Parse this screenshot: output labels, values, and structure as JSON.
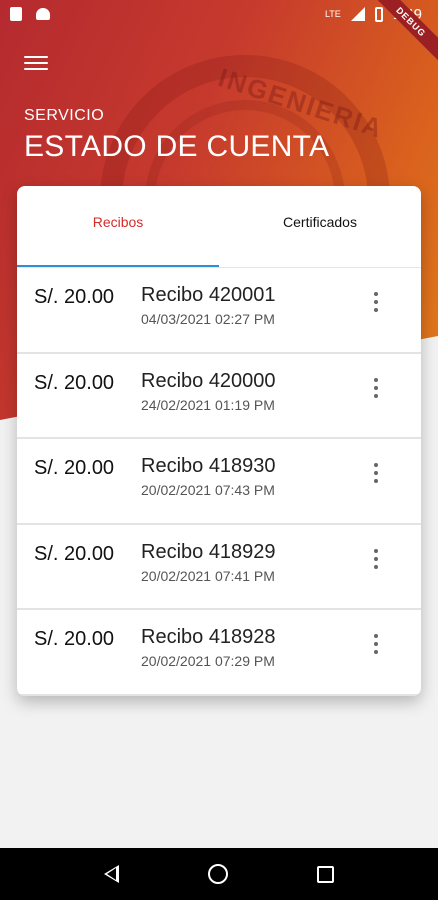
{
  "status_bar": {
    "network": "LTE",
    "time": "1:49",
    "debug_banner": "DEBUG"
  },
  "header": {
    "section": "SERVICIO",
    "title": "ESTADO DE CUENTA",
    "watermark_text": "INGENIERIA"
  },
  "tabs": [
    {
      "label": "Recibos",
      "active": true
    },
    {
      "label": "Certificados",
      "active": false
    }
  ],
  "receipts": [
    {
      "amount": "S/. 20.00",
      "title": "Recibo 420001",
      "date": "04/03/2021 02:27 PM"
    },
    {
      "amount": "S/. 20.00",
      "title": "Recibo 420000",
      "date": "24/02/2021 01:19 PM"
    },
    {
      "amount": "S/. 20.00",
      "title": "Recibo 418930",
      "date": "20/02/2021 07:43 PM"
    },
    {
      "amount": "S/. 20.00",
      "title": "Recibo 418929",
      "date": "20/02/2021 07:41 PM"
    },
    {
      "amount": "S/. 20.00",
      "title": "Recibo 418928",
      "date": "20/02/2021 07:29 PM"
    }
  ],
  "colors": {
    "accent_red": "#d62b2b",
    "tab_indicator": "#2d8fd6",
    "header_gradient_start": "#b52a2f",
    "header_gradient_end": "#e07d1b"
  },
  "icons": {
    "menu": "hamburger-icon",
    "row_more": "more-vertical-icon",
    "nav_back": "back-triangle-icon",
    "nav_home": "home-circle-icon",
    "nav_recent": "recent-square-icon"
  }
}
